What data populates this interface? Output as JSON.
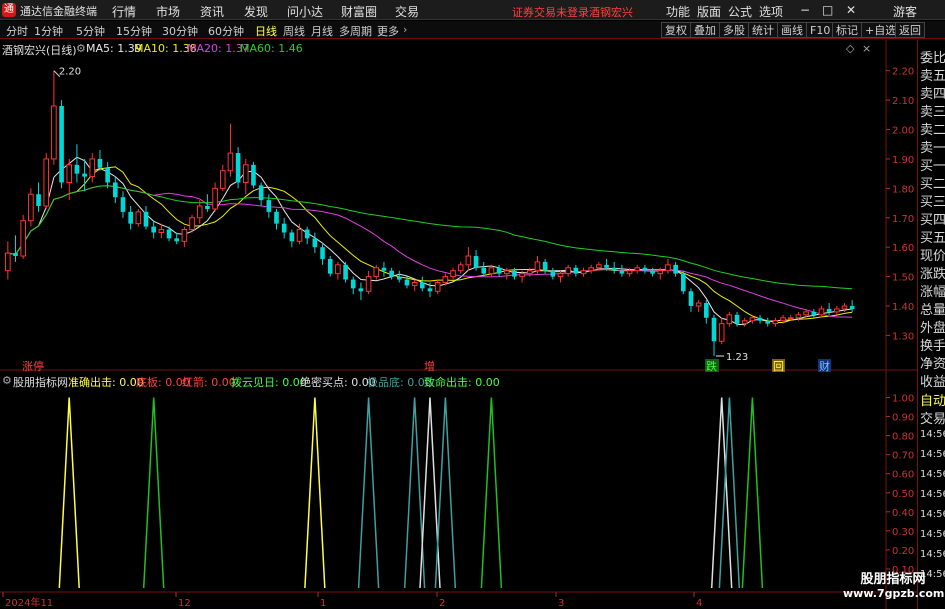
{
  "app": {
    "logo": "通",
    "title": "通达信金融终端",
    "menu": [
      "行情",
      "市场",
      "资讯",
      "发现",
      "问小达",
      "财富圈",
      "交易"
    ],
    "alert_login": "证券交易未登录",
    "alert_stock": "酒钢宏兴",
    "right_menu": [
      "功能",
      "版面",
      "公式",
      "选项"
    ],
    "window_controls": [
      "−",
      "□",
      "✕"
    ],
    "guest": "游客"
  },
  "toolbar": {
    "timeframes": [
      "分时",
      "1分钟",
      "5分钟",
      "15分钟",
      "30分钟",
      "60分钟",
      "日线",
      "周线",
      "月线",
      "多周期",
      "更多"
    ],
    "active": "日线",
    "right_buttons": [
      "复权",
      "叠加",
      "多股",
      "统计",
      "画线",
      "F10",
      "标记",
      "+自选",
      "返回"
    ]
  },
  "main_legend": {
    "title": "酒钢宏兴(日线)",
    "ma": [
      {
        "label": "MA5: 1.39",
        "color": "#e8e8e8"
      },
      {
        "label": "MA10: 1.38",
        "color": "#f0f000"
      },
      {
        "label": "MA20: 1.37",
        "color": "#e040e0"
      },
      {
        "label": "MA60: 1.46",
        "color": "#20d020"
      }
    ]
  },
  "indicator_legend": {
    "title": "股朋指标网",
    "items": [
      {
        "label": "准确出击: 0.00",
        "color": "#ffff40"
      },
      {
        "label": "底板: 0.00",
        "color": "#ff4040"
      },
      {
        "label": "红箭: 0.00",
        "color": "#ff4040"
      },
      {
        "label": "拨云见日: 0.00",
        "color": "#40ff40"
      },
      {
        "label": "绝密买点: 0.00",
        "color": "#e0e0e0"
      },
      {
        "label": "极品底: 0.00",
        "color": "#40a0a0"
      },
      {
        "label": "致命出击: 0.00",
        "color": "#40ff40"
      }
    ]
  },
  "right_panel": {
    "items": [
      "委比",
      "卖五",
      "卖四",
      "卖三",
      "卖二",
      "卖一",
      "买一",
      "买二",
      "买三",
      "买四",
      "买五",
      "现价",
      "涨跌",
      "涨幅",
      "总量",
      "外盘",
      "换手",
      "净资",
      "收益"
    ],
    "bottom": [
      "自动",
      "交易"
    ],
    "times": [
      "14:56",
      "14:56",
      "14:56",
      "14:56",
      "14:56",
      "14:56",
      "14:56",
      "14:56",
      "14:56"
    ]
  },
  "markers": {
    "high": "2.20",
    "low": "1.23",
    "limit_up": "涨停",
    "add": "增",
    "down": "跌",
    "back": "回",
    "fin": "财"
  },
  "watermark": {
    "line1": "股朋指标网",
    "line2": "www.7gpzb.com"
  },
  "chart_data": {
    "type": "candlestick",
    "ylim": [
      1.23,
      2.25
    ],
    "y_ticks": [
      "2.20",
      "2.10",
      "2.00",
      "1.90",
      "1.80",
      "1.70",
      "1.60",
      "1.50",
      "1.40",
      "1.30"
    ],
    "x_ticks": [
      "2024年11",
      "12",
      "1",
      "2",
      "3",
      "4"
    ],
    "indicator_ylim": [
      0,
      1.05
    ],
    "indicator_ticks": [
      "1.00",
      "0.90",
      "0.80",
      "0.70",
      "0.60",
      "0.50",
      "0.40",
      "0.30",
      "0.20",
      "0.10"
    ],
    "ohlc": [
      [
        1.52,
        1.62,
        1.49,
        1.58
      ],
      [
        1.58,
        1.64,
        1.55,
        1.57
      ],
      [
        1.57,
        1.71,
        1.56,
        1.69
      ],
      [
        1.69,
        1.8,
        1.67,
        1.78
      ],
      [
        1.78,
        1.82,
        1.72,
        1.74
      ],
      [
        1.74,
        1.92,
        1.73,
        1.9
      ],
      [
        1.9,
        2.2,
        1.88,
        2.08
      ],
      [
        2.08,
        2.1,
        1.8,
        1.82
      ],
      [
        1.82,
        1.9,
        1.76,
        1.88
      ],
      [
        1.88,
        1.95,
        1.82,
        1.85
      ],
      [
        1.85,
        1.9,
        1.79,
        1.84
      ],
      [
        1.84,
        1.92,
        1.82,
        1.9
      ],
      [
        1.9,
        1.93,
        1.86,
        1.87
      ],
      [
        1.87,
        1.89,
        1.8,
        1.82
      ],
      [
        1.82,
        1.84,
        1.75,
        1.77
      ],
      [
        1.77,
        1.79,
        1.7,
        1.72
      ],
      [
        1.72,
        1.74,
        1.66,
        1.68
      ],
      [
        1.68,
        1.73,
        1.67,
        1.72
      ],
      [
        1.72,
        1.74,
        1.66,
        1.67
      ],
      [
        1.67,
        1.69,
        1.63,
        1.65
      ],
      [
        1.65,
        1.68,
        1.63,
        1.66
      ],
      [
        1.66,
        1.67,
        1.62,
        1.63
      ],
      [
        1.63,
        1.65,
        1.61,
        1.62
      ],
      [
        1.62,
        1.67,
        1.6,
        1.66
      ],
      [
        1.66,
        1.71,
        1.65,
        1.7
      ],
      [
        1.7,
        1.76,
        1.68,
        1.74
      ],
      [
        1.74,
        1.78,
        1.72,
        1.73
      ],
      [
        1.73,
        1.82,
        1.72,
        1.8
      ],
      [
        1.8,
        1.88,
        1.79,
        1.86
      ],
      [
        1.86,
        2.02,
        1.84,
        1.92
      ],
      [
        1.92,
        1.94,
        1.8,
        1.82
      ],
      [
        1.82,
        1.9,
        1.78,
        1.88
      ],
      [
        1.88,
        1.89,
        1.8,
        1.81
      ],
      [
        1.81,
        1.82,
        1.74,
        1.76
      ],
      [
        1.76,
        1.78,
        1.7,
        1.72
      ],
      [
        1.72,
        1.73,
        1.66,
        1.68
      ],
      [
        1.68,
        1.7,
        1.63,
        1.65
      ],
      [
        1.65,
        1.66,
        1.6,
        1.62
      ],
      [
        1.62,
        1.68,
        1.61,
        1.66
      ],
      [
        1.66,
        1.67,
        1.61,
        1.63
      ],
      [
        1.63,
        1.65,
        1.58,
        1.6
      ],
      [
        1.6,
        1.61,
        1.54,
        1.56
      ],
      [
        1.56,
        1.57,
        1.5,
        1.51
      ],
      [
        1.51,
        1.55,
        1.49,
        1.54
      ],
      [
        1.54,
        1.55,
        1.48,
        1.49
      ],
      [
        1.49,
        1.5,
        1.44,
        1.46
      ],
      [
        1.46,
        1.48,
        1.42,
        1.45
      ],
      [
        1.45,
        1.52,
        1.44,
        1.5
      ],
      [
        1.5,
        1.54,
        1.49,
        1.53
      ],
      [
        1.53,
        1.55,
        1.5,
        1.52
      ],
      [
        1.52,
        1.53,
        1.49,
        1.5
      ],
      [
        1.5,
        1.52,
        1.48,
        1.49
      ],
      [
        1.49,
        1.5,
        1.46,
        1.47
      ],
      [
        1.47,
        1.49,
        1.45,
        1.48
      ],
      [
        1.48,
        1.5,
        1.45,
        1.46
      ],
      [
        1.46,
        1.48,
        1.43,
        1.45
      ],
      [
        1.45,
        1.49,
        1.44,
        1.48
      ],
      [
        1.48,
        1.51,
        1.47,
        1.5
      ],
      [
        1.5,
        1.53,
        1.49,
        1.52
      ],
      [
        1.52,
        1.55,
        1.51,
        1.54
      ],
      [
        1.54,
        1.6,
        1.52,
        1.57
      ],
      [
        1.57,
        1.59,
        1.52,
        1.53
      ],
      [
        1.53,
        1.55,
        1.5,
        1.51
      ],
      [
        1.51,
        1.54,
        1.5,
        1.53
      ],
      [
        1.53,
        1.54,
        1.5,
        1.51
      ],
      [
        1.51,
        1.53,
        1.49,
        1.52
      ],
      [
        1.52,
        1.53,
        1.49,
        1.5
      ],
      [
        1.5,
        1.52,
        1.48,
        1.51
      ],
      [
        1.51,
        1.53,
        1.5,
        1.52
      ],
      [
        1.52,
        1.57,
        1.51,
        1.55
      ],
      [
        1.55,
        1.56,
        1.51,
        1.52
      ],
      [
        1.52,
        1.53,
        1.49,
        1.5
      ],
      [
        1.5,
        1.52,
        1.48,
        1.51
      ],
      [
        1.51,
        1.54,
        1.5,
        1.53
      ],
      [
        1.53,
        1.54,
        1.5,
        1.51
      ],
      [
        1.51,
        1.53,
        1.5,
        1.52
      ],
      [
        1.52,
        1.54,
        1.51,
        1.53
      ],
      [
        1.53,
        1.55,
        1.52,
        1.54
      ],
      [
        1.54,
        1.56,
        1.52,
        1.53
      ],
      [
        1.53,
        1.55,
        1.51,
        1.52
      ],
      [
        1.52,
        1.54,
        1.5,
        1.51
      ],
      [
        1.51,
        1.53,
        1.5,
        1.52
      ],
      [
        1.52,
        1.54,
        1.51,
        1.53
      ],
      [
        1.53,
        1.54,
        1.51,
        1.52
      ],
      [
        1.52,
        1.53,
        1.5,
        1.51
      ],
      [
        1.51,
        1.53,
        1.49,
        1.52
      ],
      [
        1.52,
        1.56,
        1.51,
        1.54
      ],
      [
        1.54,
        1.55,
        1.5,
        1.51
      ],
      [
        1.51,
        1.52,
        1.44,
        1.45
      ],
      [
        1.45,
        1.46,
        1.38,
        1.4
      ],
      [
        1.4,
        1.42,
        1.38,
        1.41
      ],
      [
        1.41,
        1.42,
        1.34,
        1.36
      ],
      [
        1.36,
        1.37,
        1.23,
        1.28
      ],
      [
        1.28,
        1.36,
        1.27,
        1.34
      ],
      [
        1.34,
        1.38,
        1.33,
        1.37
      ],
      [
        1.37,
        1.38,
        1.33,
        1.34
      ],
      [
        1.34,
        1.36,
        1.33,
        1.35
      ],
      [
        1.35,
        1.37,
        1.34,
        1.36
      ],
      [
        1.36,
        1.37,
        1.34,
        1.35
      ],
      [
        1.35,
        1.36,
        1.33,
        1.34
      ],
      [
        1.34,
        1.36,
        1.33,
        1.35
      ],
      [
        1.35,
        1.37,
        1.34,
        1.36
      ],
      [
        1.36,
        1.37,
        1.35,
        1.36
      ],
      [
        1.36,
        1.38,
        1.35,
        1.37
      ],
      [
        1.37,
        1.39,
        1.36,
        1.38
      ],
      [
        1.38,
        1.39,
        1.36,
        1.37
      ],
      [
        1.37,
        1.4,
        1.36,
        1.39
      ],
      [
        1.39,
        1.41,
        1.37,
        1.38
      ],
      [
        1.38,
        1.4,
        1.37,
        1.39
      ],
      [
        1.39,
        1.41,
        1.38,
        1.4
      ],
      [
        1.4,
        1.42,
        1.38,
        1.39
      ]
    ],
    "signals": [
      {
        "bar": 8,
        "color": "#ffff40"
      },
      {
        "bar": 19,
        "color": "#20c020"
      },
      {
        "bar": 40,
        "color": "#ffff40"
      },
      {
        "bar": 47,
        "color": "#40a0a0"
      },
      {
        "bar": 53,
        "color": "#40a0a0"
      },
      {
        "bar": 55,
        "color": "#e0e0e0"
      },
      {
        "bar": 57,
        "color": "#40a0a0"
      },
      {
        "bar": 63,
        "color": "#20c020"
      },
      {
        "bar": 93,
        "color": "#e0e0e0"
      },
      {
        "bar": 94,
        "color": "#40a0a0"
      },
      {
        "bar": 97,
        "color": "#20c020"
      }
    ]
  }
}
